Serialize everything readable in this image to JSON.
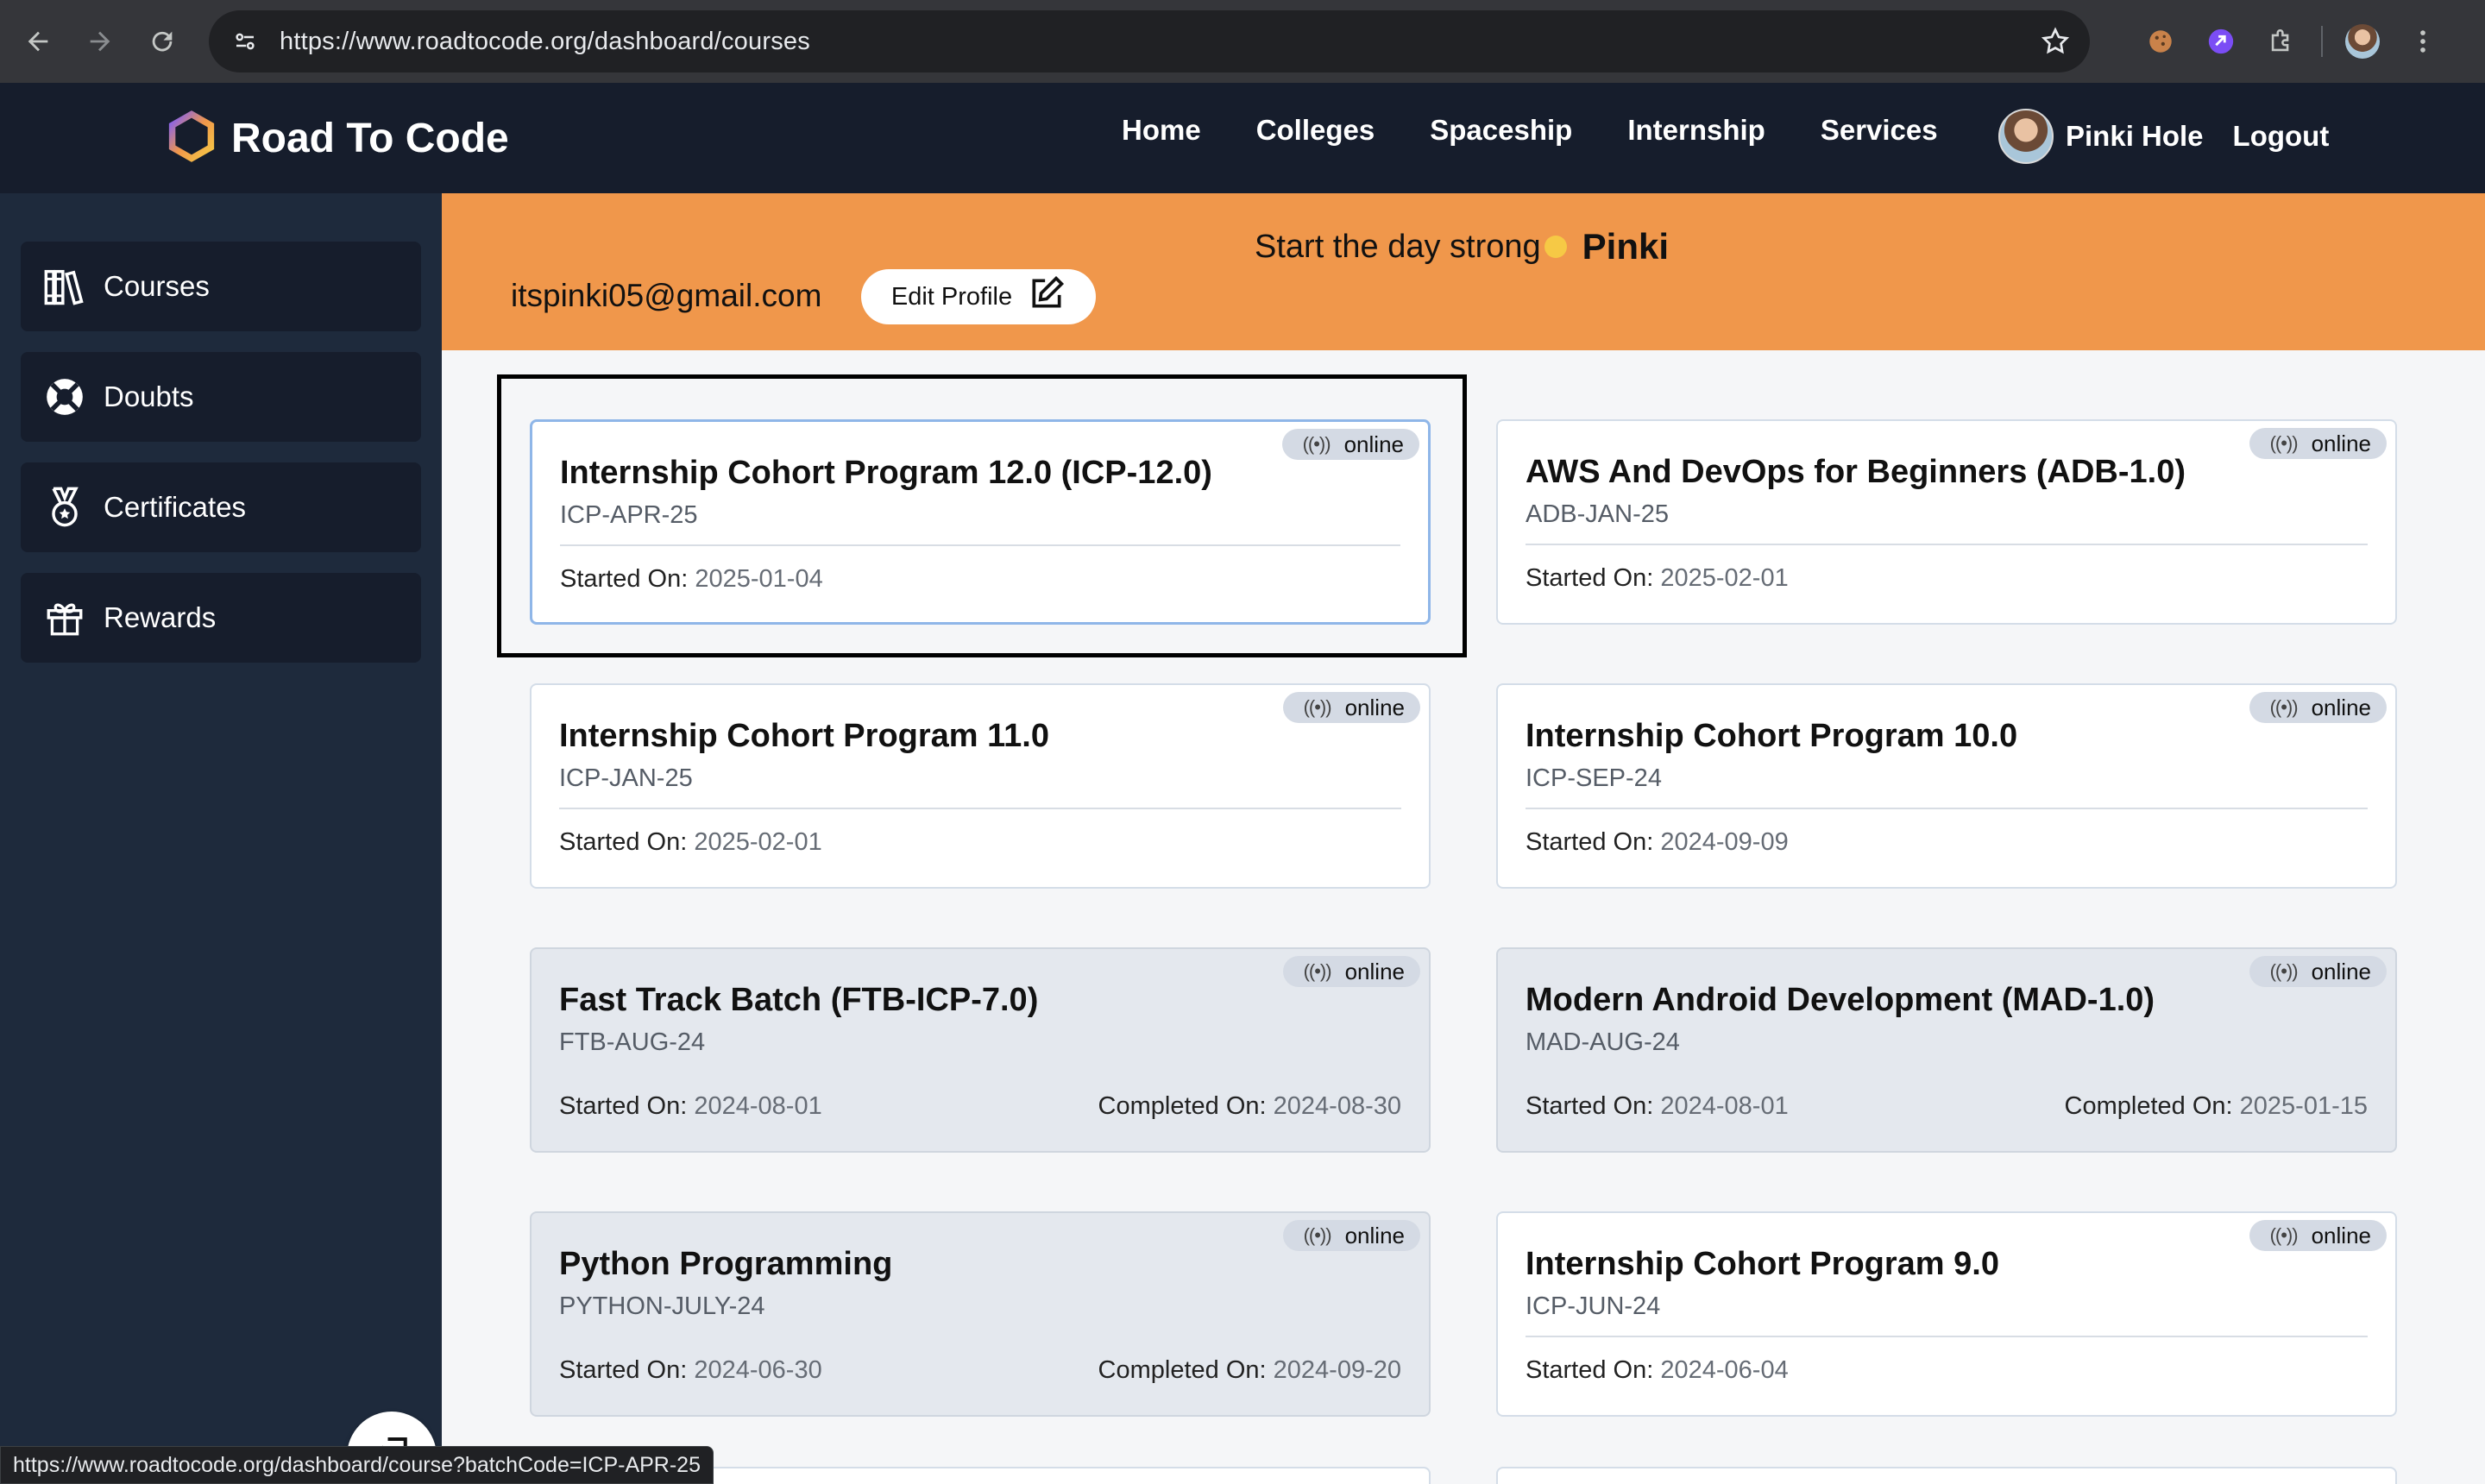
{
  "browser": {
    "url": "https://www.roadtocode.org/dashboard/courses",
    "status_url": "https://www.roadtocode.org/dashboard/course?batchCode=ICP-APR-25"
  },
  "header": {
    "brand": "Road To Code",
    "nav": [
      "Home",
      "Colleges",
      "Spaceship",
      "Internship",
      "Services"
    ],
    "user_name": "Pinki Hole",
    "logout": "Logout"
  },
  "sidebar": {
    "items": [
      {
        "label": "Courses",
        "icon": "books-icon"
      },
      {
        "label": "Doubts",
        "icon": "lifebuoy-icon"
      },
      {
        "label": "Certificates",
        "icon": "medal-icon"
      },
      {
        "label": "Rewards",
        "icon": "gift-icon"
      }
    ]
  },
  "banner": {
    "greeting": "Start the day strong",
    "name": "Pinki",
    "email": "itspinki05@gmail.com",
    "edit_profile": "Edit Profile"
  },
  "labels": {
    "started_on": "Started On:",
    "completed_on": "Completed On:"
  },
  "courses": [
    {
      "title": "Internship Cohort Program 12.0 (ICP-12.0)",
      "code": "ICP-APR-25",
      "mode": "online",
      "started": "2025-01-04",
      "completed": null
    },
    {
      "title": "AWS And DevOps for Beginners (ADB-1.0)",
      "code": "ADB-JAN-25",
      "mode": "online",
      "started": "2025-02-01",
      "completed": null
    },
    {
      "title": "Internship Cohort Program 11.0",
      "code": "ICP-JAN-25",
      "mode": "online",
      "started": "2025-02-01",
      "completed": null
    },
    {
      "title": "Internship Cohort Program 10.0",
      "code": "ICP-SEP-24",
      "mode": "online",
      "started": "2024-09-09",
      "completed": null
    },
    {
      "title": "Fast Track Batch (FTB-ICP-7.0)",
      "code": "FTB-AUG-24",
      "mode": "online",
      "started": "2024-08-01",
      "completed": "2024-08-30"
    },
    {
      "title": "Modern Android Development (MAD-1.0)",
      "code": "MAD-AUG-24",
      "mode": "online",
      "started": "2024-08-01",
      "completed": "2025-01-15"
    },
    {
      "title": "Python Programming",
      "code": "PYTHON-JULY-24",
      "mode": "online",
      "started": "2024-06-30",
      "completed": "2024-09-20"
    },
    {
      "title": "Internship Cohort Program 9.0",
      "code": "ICP-JUN-24",
      "mode": "online",
      "started": "2024-06-04",
      "completed": null
    }
  ]
}
